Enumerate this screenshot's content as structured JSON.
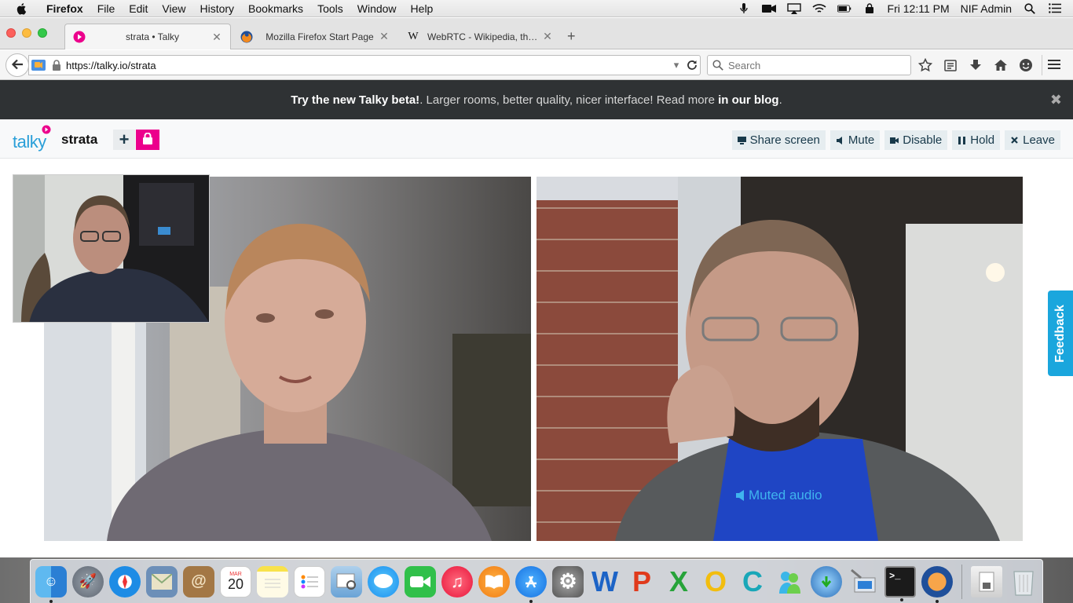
{
  "menubar": {
    "app": "Firefox",
    "items": [
      "File",
      "Edit",
      "View",
      "History",
      "Bookmarks",
      "Tools",
      "Window",
      "Help"
    ],
    "clock": "Fri 12:11 PM",
    "user": "NIF Admin"
  },
  "tabs": [
    {
      "title": "strata • Talky",
      "active": true
    },
    {
      "title": "Mozilla Firefox Start Page",
      "active": false
    },
    {
      "title": "WebRTC - Wikipedia, the fr...",
      "active": false
    }
  ],
  "navbar": {
    "url": "https://talky.io/strata",
    "search_placeholder": "Search"
  },
  "banner": {
    "lead": "Try the new Talky beta!",
    "middle": ". Larger rooms, better quality, nicer interface! Read more ",
    "link": "in our blog",
    "tail": "."
  },
  "talky": {
    "logo": "talky",
    "room": "strata",
    "add_label": "+",
    "controls": {
      "share": "Share screen",
      "mute": "Mute",
      "disable": "Disable",
      "hold": "Hold",
      "leave": "Leave"
    },
    "muted_label": "Muted audio",
    "feedback": "Feedback",
    "accent": "#ec008c",
    "brand": "#2a9fd8"
  },
  "dock": {
    "calendar_month": "MAR",
    "calendar_day": "20"
  }
}
